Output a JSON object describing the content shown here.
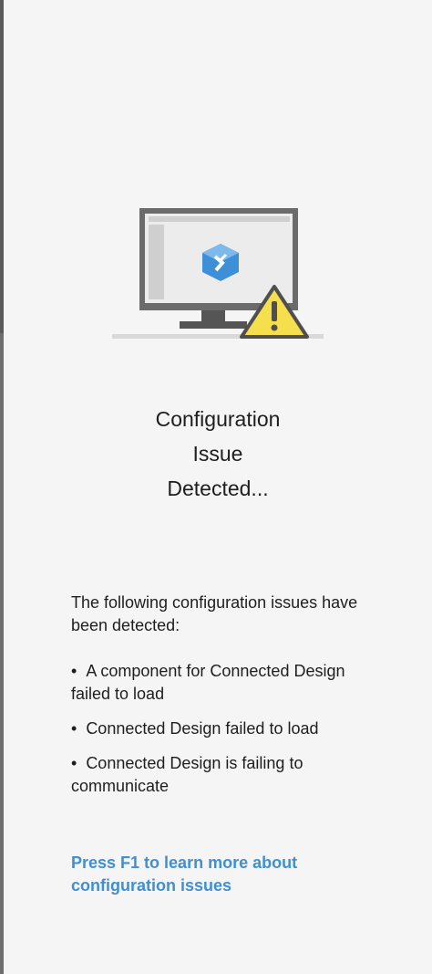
{
  "dialog": {
    "heading_lines": [
      "Configuration",
      "Issue",
      "Detected..."
    ],
    "intro_text": "The following configuration issues have been detected:",
    "issues": [
      "A component for Connected Design failed to load",
      "Connected Design failed to load",
      "Connected Design is failing to communicate"
    ],
    "bullet": "•",
    "help_link": "Press F1 to learn more about configuration issues"
  },
  "illustration": {
    "icons": [
      "monitor-icon",
      "app-logo-icon",
      "warning-icon"
    ]
  },
  "colors": {
    "background": "#f5f5f5",
    "link": "#3f8fd2",
    "text": "#1e1e1e",
    "warning_fill": "#f5df4d",
    "logo_blue": "#3d8fd8"
  }
}
